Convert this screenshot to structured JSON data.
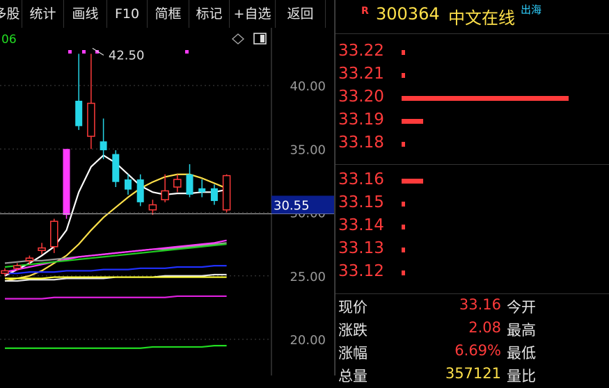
{
  "toolbar": [
    {
      "label": "多股",
      "w": 44
    },
    {
      "label": "统计",
      "w": 60
    },
    {
      "label": "画线",
      "w": 62
    },
    {
      "label": "F10",
      "w": 58
    },
    {
      "label": "简框",
      "w": 60
    },
    {
      "label": "标记",
      "w": 58
    },
    {
      "label": "+自选",
      "w": 66
    },
    {
      "label": "返回",
      "w": 72
    }
  ],
  "chart": {
    "corner_label": "06",
    "max_label": "42.50",
    "current_price_label": "30.55",
    "y_ticks": [
      "40.00",
      "35.00",
      "30.00",
      "25.00",
      "20.00"
    ],
    "colors": {
      "up": "#ff3b3b",
      "down": "#26d6e8",
      "axis": "#9a9a9a",
      "current_line": "#bdbdbd",
      "price_box": "#0a1e8c"
    }
  },
  "chart_data": {
    "type": "candlestick",
    "y_ticks": [
      40.0,
      35.0,
      30.0,
      25.0,
      20.0
    ],
    "current_price": 30.55,
    "max_marker": 42.5,
    "candles": [
      {
        "o": 25.2,
        "c": 25.4,
        "h": 25.6,
        "l": 25.0,
        "dir": "up"
      },
      {
        "o": 25.6,
        "c": 25.8,
        "h": 26.0,
        "l": 25.4,
        "dir": "up"
      },
      {
        "o": 26.2,
        "c": 26.4,
        "h": 26.6,
        "l": 25.9,
        "dir": "up"
      },
      {
        "o": 27.0,
        "c": 27.2,
        "h": 27.6,
        "l": 26.7,
        "dir": "up"
      },
      {
        "o": 27.3,
        "c": 29.3,
        "h": 29.5,
        "l": 26.8,
        "dir": "up"
      },
      {
        "o": 29.8,
        "c": 35.0,
        "h": 35.0,
        "l": 29.5,
        "dir": "up"
      },
      {
        "o": 38.8,
        "c": 36.8,
        "h": 42.5,
        "l": 36.5,
        "dir": "down"
      },
      {
        "o": 36.0,
        "c": 38.6,
        "h": 42.5,
        "l": 35.0,
        "dir": "up"
      },
      {
        "o": 35.6,
        "c": 34.9,
        "h": 37.4,
        "l": 34.2,
        "dir": "down"
      },
      {
        "o": 34.6,
        "c": 32.4,
        "h": 34.9,
        "l": 32.0,
        "dir": "down"
      },
      {
        "o": 32.6,
        "c": 31.8,
        "h": 33.0,
        "l": 31.4,
        "dir": "down"
      },
      {
        "o": 32.6,
        "c": 30.8,
        "h": 33.0,
        "l": 30.5,
        "dir": "down"
      },
      {
        "o": 30.2,
        "c": 30.6,
        "h": 31.0,
        "l": 29.8,
        "dir": "up"
      },
      {
        "o": 31.0,
        "c": 31.7,
        "h": 33.0,
        "l": 30.8,
        "dir": "up"
      },
      {
        "o": 32.0,
        "c": 32.6,
        "h": 33.0,
        "l": 31.6,
        "dir": "up"
      },
      {
        "o": 33.0,
        "c": 31.4,
        "h": 33.8,
        "l": 31.2,
        "dir": "down"
      },
      {
        "o": 31.9,
        "c": 31.6,
        "h": 32.6,
        "l": 31.2,
        "dir": "down"
      },
      {
        "o": 31.9,
        "c": 30.9,
        "h": 32.2,
        "l": 30.6,
        "dir": "down"
      },
      {
        "o": 30.2,
        "c": 32.9,
        "h": 33.0,
        "l": 30.0,
        "dir": "up"
      }
    ],
    "ma_lines": [
      {
        "color": "#ffffff",
        "values": [
          25.0,
          25.5,
          26.0,
          26.6,
          27.3,
          28.6,
          31.6,
          33.6,
          34.5,
          33.9,
          33.0,
          32.1,
          31.6,
          31.4,
          31.5,
          31.5,
          31.6,
          31.6,
          31.8
        ]
      },
      {
        "color": "#ffe14a",
        "values": [
          24.6,
          24.8,
          25.0,
          25.4,
          26.0,
          26.6,
          27.5,
          28.6,
          29.6,
          30.4,
          31.2,
          31.9,
          32.4,
          32.8,
          33.0,
          33.0,
          32.7,
          32.3,
          31.9
        ]
      },
      {
        "color": "#9a9a9a",
        "values": [
          26.0,
          26.1,
          26.2,
          26.2,
          26.3,
          26.4,
          26.5,
          26.6,
          26.7,
          26.8,
          26.9,
          27.0,
          27.1,
          27.1,
          27.2,
          27.3,
          27.4,
          27.5,
          27.6
        ]
      },
      {
        "color": "#ff3bff",
        "values": [
          25.3,
          25.5,
          25.7,
          25.9,
          26.1,
          26.3,
          26.5,
          26.6,
          26.7,
          26.8,
          26.9,
          27.0,
          27.1,
          27.2,
          27.3,
          27.4,
          27.5,
          27.6,
          27.8
        ]
      },
      {
        "color": "#22cc22",
        "values": [
          25.7,
          25.8,
          25.9,
          26.0,
          26.1,
          26.2,
          26.3,
          26.4,
          26.5,
          26.6,
          26.7,
          26.8,
          26.9,
          27.0,
          27.1,
          27.2,
          27.3,
          27.4,
          27.5
        ]
      },
      {
        "color": "#2030ff",
        "values": [
          25.2,
          25.2,
          25.3,
          25.3,
          25.3,
          25.4,
          25.4,
          25.4,
          25.5,
          25.5,
          25.5,
          25.6,
          25.6,
          25.6,
          25.7,
          25.7,
          25.7,
          25.8,
          25.8
        ]
      },
      {
        "color": "#e6e6e6",
        "values": [
          24.6,
          24.6,
          24.7,
          24.7,
          24.7,
          24.8,
          24.8,
          24.8,
          24.8,
          24.9,
          24.9,
          24.9,
          24.9,
          25.0,
          25.0,
          25.0,
          25.0,
          25.1,
          25.1
        ]
      },
      {
        "color": "#ffff33",
        "values": [
          24.8,
          24.8,
          24.8,
          24.8,
          24.9,
          24.9,
          24.9,
          24.9,
          24.9,
          24.9,
          24.9,
          24.9,
          24.9,
          24.9,
          24.9,
          24.9,
          24.9,
          24.9,
          24.9
        ]
      },
      {
        "color": "#e020e0",
        "values": [
          23.2,
          23.2,
          23.2,
          23.2,
          23.3,
          23.3,
          23.3,
          23.3,
          23.3,
          23.3,
          23.3,
          23.3,
          23.3,
          23.3,
          23.4,
          23.4,
          23.4,
          23.4,
          23.4
        ]
      },
      {
        "color": "#22dd22",
        "values": [
          19.3,
          19.3,
          19.3,
          19.3,
          19.3,
          19.3,
          19.3,
          19.3,
          19.3,
          19.3,
          19.3,
          19.3,
          19.4,
          19.4,
          19.4,
          19.4,
          19.4,
          19.5,
          19.5
        ]
      }
    ]
  },
  "stock": {
    "badge": "R",
    "code": "300364",
    "name": "中文在线",
    "tag": "出海"
  },
  "asks": [
    {
      "price": "33.22",
      "volume_frac": 0.02
    },
    {
      "price": "33.21",
      "volume_frac": 0.02
    },
    {
      "price": "33.20",
      "volume_frac": 1.0
    },
    {
      "price": "33.19",
      "volume_frac": 0.13
    },
    {
      "price": "33.18",
      "volume_frac": 0.02
    }
  ],
  "bids": [
    {
      "price": "33.16",
      "volume_frac": 0.13
    },
    {
      "price": "33.15",
      "volume_frac": 0.015
    },
    {
      "price": "33.14",
      "volume_frac": 0.015
    },
    {
      "price": "33.13",
      "volume_frac": 0.02
    },
    {
      "price": "33.12",
      "volume_frac": 0.02
    }
  ],
  "quote": [
    {
      "label": "现价",
      "value": "33.16",
      "value_color": "#ff3b3b",
      "right_label": "今开"
    },
    {
      "label": "涨跌",
      "value": "2.08",
      "value_color": "#ff3b3b",
      "right_label": "最高"
    },
    {
      "label": "涨幅",
      "value": "6.69%",
      "value_color": "#ff3b3b",
      "right_label": "最低"
    },
    {
      "label": "总量",
      "value": "357121",
      "value_color": "#ffe14a",
      "right_label": "量比"
    }
  ]
}
